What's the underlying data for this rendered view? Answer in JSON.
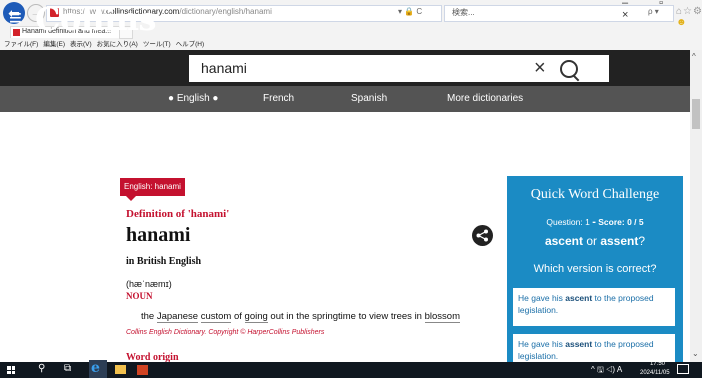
{
  "browser": {
    "url_prefix": "https://www.",
    "url_domain": "collinsdictionary.com",
    "url_path": "/dictionary/english/hanami",
    "addr_controls": "▾ 🔒 C",
    "search_placeholder": "検索...",
    "search_controls": "ρ ▾",
    "tab_title": "Hanami definition and mea...",
    "tab_close": "×",
    "window_controls": "–  ▫  ×",
    "menu": [
      "ファイル(F)",
      "編集(E)",
      "表示(V)",
      "お気に入り(A)",
      "ツール(T)",
      "ヘルプ(H)"
    ]
  },
  "header": {
    "logo": "Collins",
    "search_query": "hanami",
    "clear_icon": "×"
  },
  "languages": [
    "English",
    "French",
    "Spanish",
    "More dictionaries"
  ],
  "entry": {
    "tag": "English: hanami",
    "definition_of": "Definition of 'hanami'",
    "headword": "hanami",
    "variety": "in British English",
    "pronunciation": "(hæˈnæmɪ)",
    "part_of_speech": "NOUN",
    "definition_parts": [
      "the ",
      "Japanese",
      " ",
      "custom",
      " of ",
      "going",
      " out in the springtime to view trees in ",
      "blossom"
    ],
    "copyright": "Collins English Dictionary. Copyright © HarperCollins Publishers",
    "origin_heading": "Word origin"
  },
  "challenge": {
    "title": "Quick Word Challenge",
    "question_label": "Question: 1",
    "score_label": "Score: 0 / 5",
    "word_a": "ascent",
    "or": "or",
    "word_b": "assent",
    "prompt": "Which version is correct?",
    "options": [
      {
        "pre": "He gave his ",
        "word": "ascent",
        "post": " to the proposed legislation."
      },
      {
        "pre": "He gave his ",
        "word": "assent",
        "post": " to the proposed legislation."
      }
    ]
  },
  "taskbar": {
    "tray": "^ 🖫 ◁) A",
    "time": "17:50",
    "date": "2024/11/05"
  },
  "colors": {
    "brand_red": "#c4112f",
    "challenge_blue": "#1b8bc4",
    "header_dark": "#222222",
    "lang_bar": "#545454"
  }
}
